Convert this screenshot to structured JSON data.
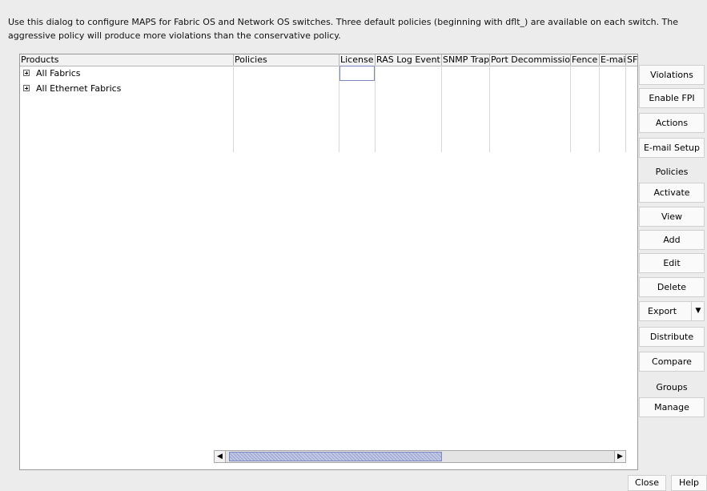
{
  "description": "Use this dialog to configure MAPS for Fabric OS and Network OS switches. Three default policies (beginning with dflt_) are available on each switch. The aggressive policy will produce more violations than the conservative policy.",
  "table": {
    "columns": [
      "Products",
      "Policies",
      "License",
      "RAS Log Event",
      "SNMP Trap",
      "Port Decommission",
      "Fence",
      "E-mail",
      "SF"
    ],
    "rows": [
      {
        "label": "All Fabrics"
      },
      {
        "label": "All Ethernet Fabrics"
      }
    ]
  },
  "side_panel": {
    "violations": "Violations",
    "enable_fpi": "Enable FPI",
    "actions": "Actions",
    "email_setup": "E-mail Setup",
    "policies_label": "Policies",
    "activate": "Activate",
    "view": "View",
    "add": "Add",
    "edit": "Edit",
    "delete": "Delete",
    "export": "Export",
    "distribute": "Distribute",
    "compare": "Compare",
    "groups_label": "Groups",
    "manage": "Manage"
  },
  "footer": {
    "close": "Close",
    "help": "Help"
  }
}
